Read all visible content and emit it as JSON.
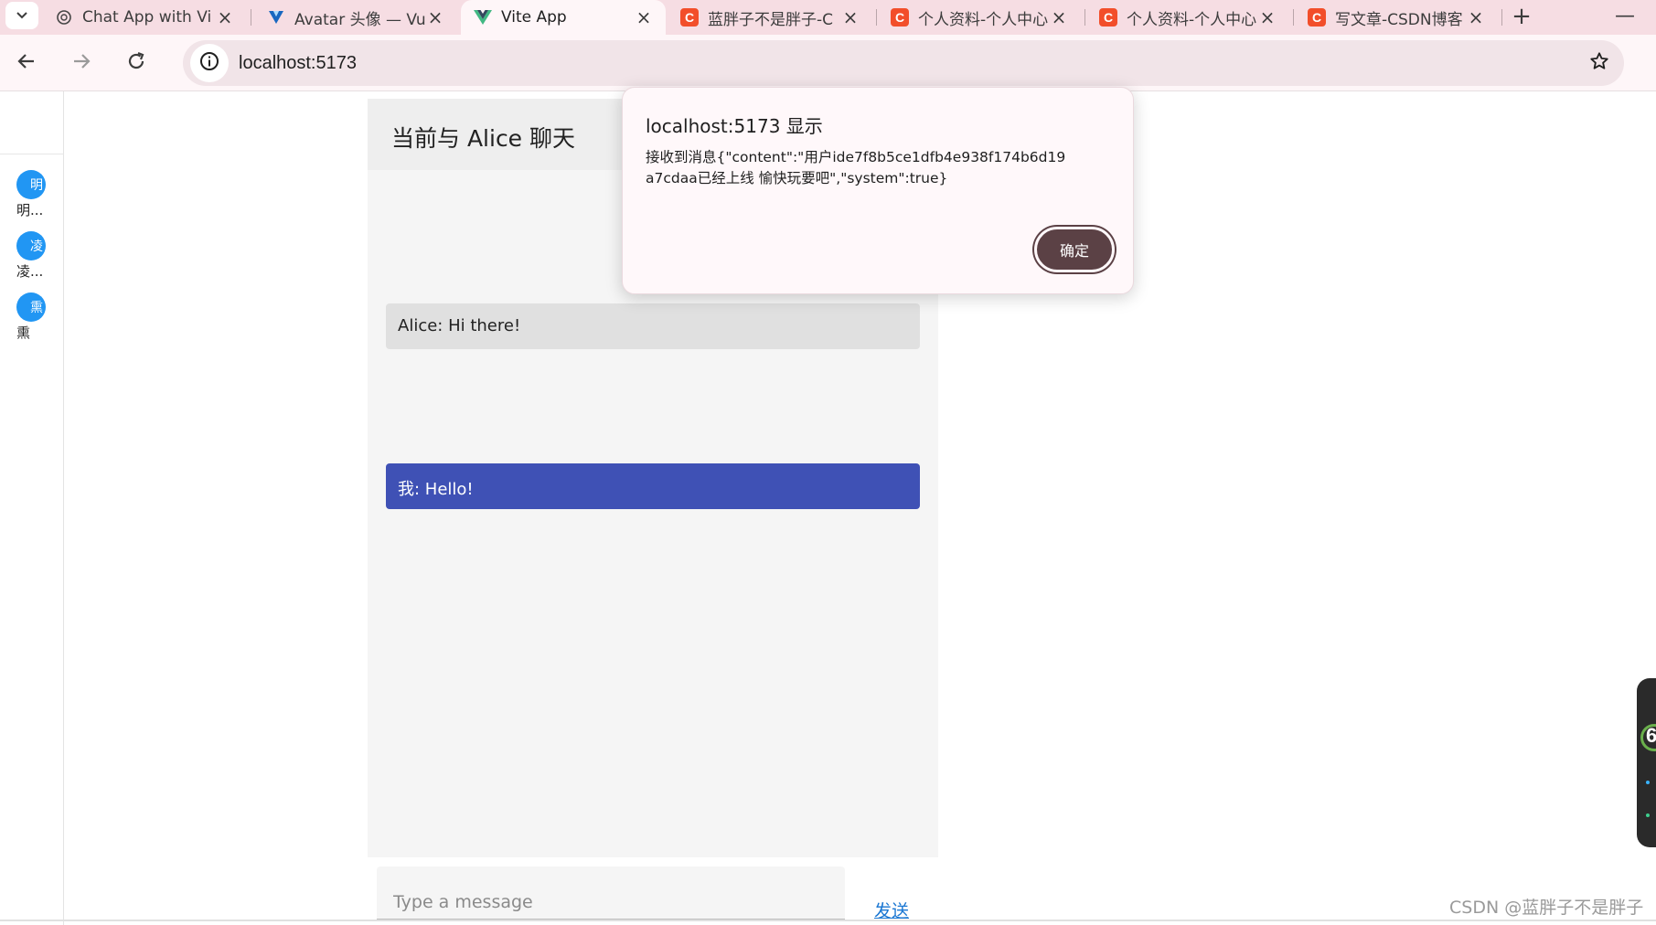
{
  "browser": {
    "tabs": [
      {
        "title": "Chat App with Vi",
        "favicon": "openai-icon"
      },
      {
        "title": "Avatar 头像 — Vu",
        "favicon": "vuetify-icon"
      },
      {
        "title": "Vite App",
        "favicon": "vue-icon",
        "active": true
      },
      {
        "title": "蓝胖子不是胖子-C",
        "favicon": "csdn-icon"
      },
      {
        "title": "个人资料-个人中心",
        "favicon": "csdn-icon"
      },
      {
        "title": "个人资料-个人中心",
        "favicon": "csdn-icon"
      },
      {
        "title": "写文章-CSDN博客",
        "favicon": "csdn-icon"
      }
    ],
    "csdn_letter": "C",
    "new_tab_symbol": "+",
    "minimize_symbol": "—",
    "close_symbol": "×",
    "url": "localhost:5173"
  },
  "sidebar": {
    "contacts": [
      {
        "avatar_text": "明",
        "name": "明..."
      },
      {
        "avatar_text": "凌",
        "name": "凌..."
      },
      {
        "avatar_text": "熏",
        "name": "熏"
      }
    ]
  },
  "chat": {
    "title": "当前与 Alice 聊天",
    "messages": [
      {
        "text": "Alice: Hi there!",
        "direction": "in"
      },
      {
        "text": "我: Hello!",
        "direction": "out"
      }
    ],
    "input_placeholder": "Type a message",
    "send_label": "发送"
  },
  "dialog": {
    "title": "localhost:5173 显示",
    "message": "接收到消息{\"content\":\"用户ide7f8b5ce1dfb4e938f174b6d19a7cdaa已经上线 愉快玩要吧\",\"system\":true}",
    "ok_label": "确定"
  },
  "widget": {
    "number": "6"
  },
  "watermark": "CSDN @蓝胖子不是胖子",
  "colors": {
    "tabstrip": "#f6dde3",
    "toolbar": "#fef6f8",
    "out_bubble": "#3f51b5",
    "in_bubble": "#e0e0e0",
    "avatar": "#2196f3",
    "dialog_button": "#5b4145",
    "link": "#1976d2"
  }
}
